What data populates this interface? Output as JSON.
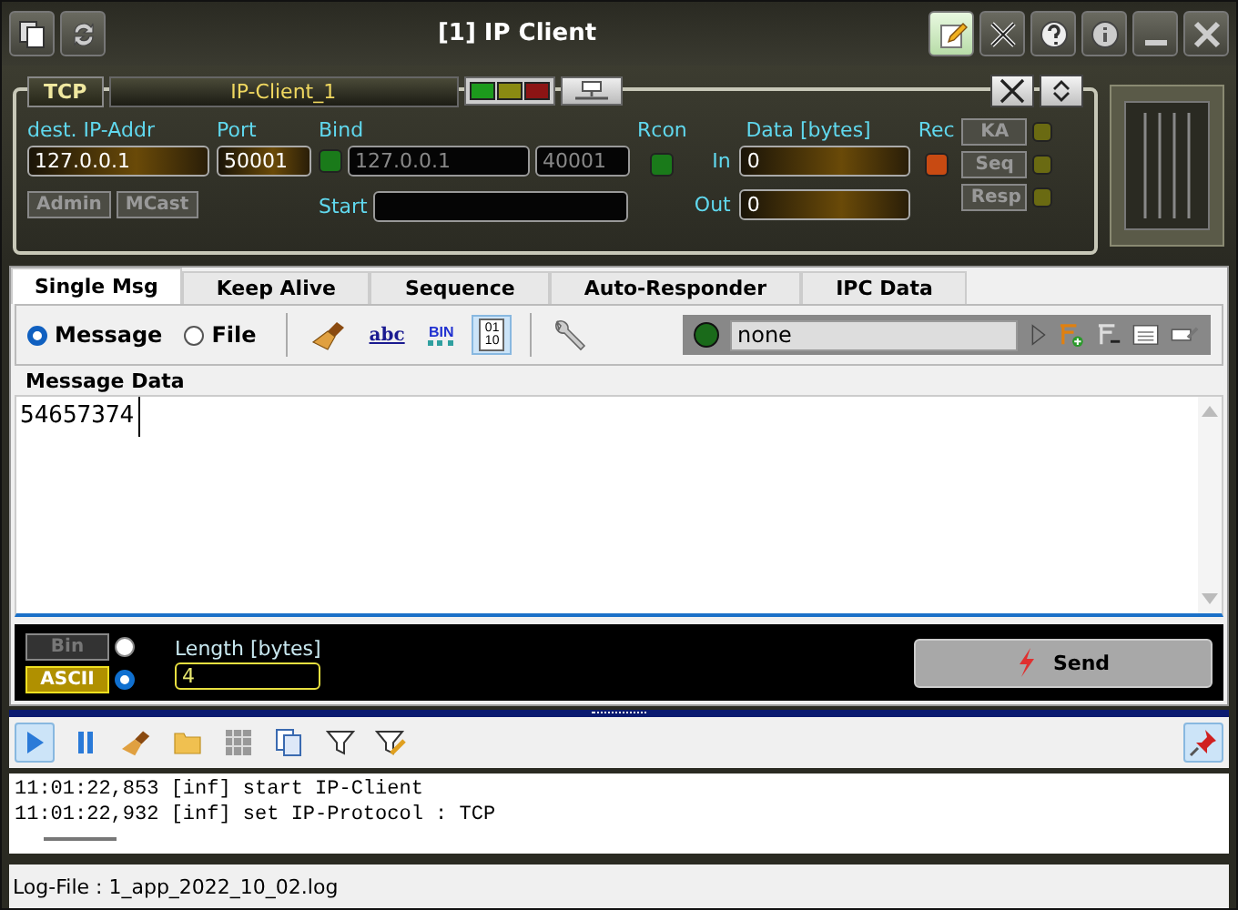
{
  "window": {
    "title": "[1] IP Client"
  },
  "connection": {
    "protocol": "TCP",
    "name": "IP-Client_1",
    "status_lights": [
      {
        "color": "#1c9a1c"
      },
      {
        "color": "#8a8a12"
      },
      {
        "color": "#8c1414"
      }
    ],
    "dest_ip": {
      "label": "dest. IP-Addr",
      "value": "127.0.0.1"
    },
    "port": {
      "label": "Port",
      "value": "50001"
    },
    "options": [
      {
        "label": "Admin",
        "disabled": true
      },
      {
        "label": "MCast",
        "disabled": true
      }
    ],
    "bind": {
      "label": "Bind",
      "color": "#1a7a1a",
      "ip": "127.0.0.1",
      "port": "40001"
    },
    "start": {
      "label": "Start"
    },
    "rcon": {
      "label": "Rcon",
      "color": "#1a7a1a"
    },
    "data": {
      "label": "Data [bytes]",
      "in_label": "In",
      "in_value": "0",
      "out_label": "Out",
      "out_value": "0"
    },
    "rec": {
      "label": "Rec",
      "color": "#c84a12"
    },
    "side_buttons": [
      {
        "label": "KA",
        "color": "#6a6a12"
      },
      {
        "label": "Seq",
        "color": "#6a6a12"
      },
      {
        "label": "Resp",
        "color": "#6a6a12"
      }
    ]
  },
  "tabs": [
    {
      "label": "Single Msg",
      "selected": true
    },
    {
      "label": "Keep Alive",
      "selected": false
    },
    {
      "label": "Sequence",
      "selected": false
    },
    {
      "label": "Auto-Responder",
      "selected": false
    },
    {
      "label": "IPC Data",
      "selected": false
    }
  ],
  "modes": [
    {
      "label": "Message",
      "selected": true
    },
    {
      "label": "File",
      "selected": false
    }
  ],
  "formats": [
    {
      "kind": "abc",
      "label": "abc",
      "selected": false
    },
    {
      "kind": "bin",
      "label": "BIN",
      "selected": false
    },
    {
      "kind": "hex",
      "lines": [
        "01",
        "10"
      ],
      "selected": true
    }
  ],
  "script": {
    "value": "none"
  },
  "message": {
    "label": "Message Data",
    "text": "54657374"
  },
  "encoding": [
    {
      "label": "Bin",
      "selected": false
    },
    {
      "label": "ASCII",
      "selected": true
    }
  ],
  "length": {
    "label": "Length [bytes]",
    "value": "4"
  },
  "send": {
    "label": "Send"
  },
  "log_tools": [
    {
      "kind": "play",
      "selected": true
    },
    {
      "kind": "pause",
      "selected": false
    },
    {
      "kind": "broom",
      "selected": false
    },
    {
      "kind": "folder",
      "selected": false
    },
    {
      "kind": "grid",
      "selected": false
    },
    {
      "kind": "copy",
      "selected": false
    },
    {
      "kind": "filter",
      "selected": false
    },
    {
      "kind": "filter-edit",
      "selected": false
    }
  ],
  "log_pin": {
    "selected": true
  },
  "log": [
    "11:01:22,853 [inf] start IP-Client",
    "11:01:22,932 [inf] set IP-Protocol : TCP"
  ],
  "status_bar": "Log-File : 1_app_2022_10_02.log"
}
